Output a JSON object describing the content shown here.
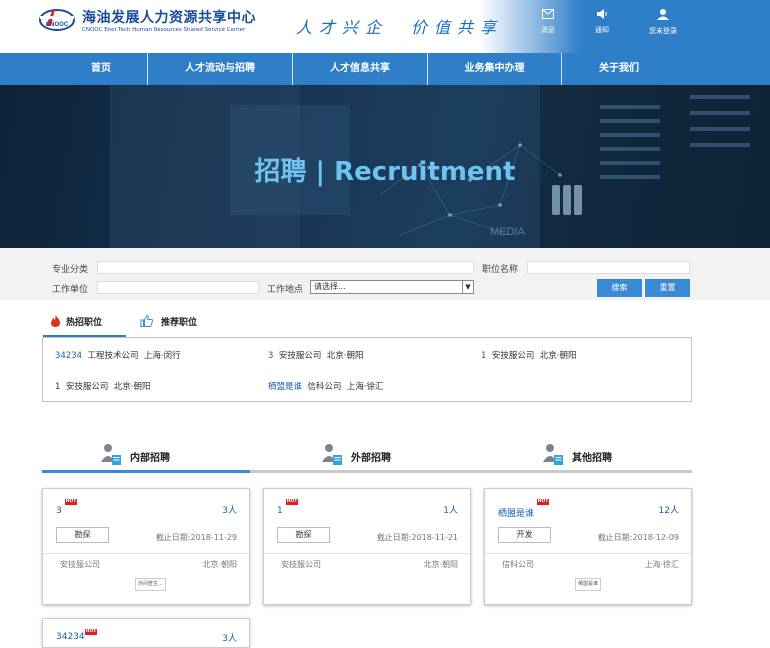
{
  "header": {
    "logo_title": "海油发展人力资源共享中心",
    "logo_subtitle": "CNOOC Ener.Tech Human Resources Shared Service Center",
    "logo_mark_text": "CNOOC",
    "slogan": "人才兴企　价值共享",
    "icons": [
      {
        "name": "message-icon",
        "label": "消息"
      },
      {
        "name": "notification-icon",
        "label": "通知"
      },
      {
        "name": "user-icon",
        "label": "您未登录"
      }
    ]
  },
  "nav": [
    "首页",
    "人才流动与招聘",
    "人才信息共享",
    "业务集中办理",
    "关于我们"
  ],
  "banner": {
    "title": "招聘 | Recruitment",
    "deco_text": "MEDIA"
  },
  "search": {
    "label_category": "专业分类",
    "label_position": "职位名称",
    "label_unit": "工作单位",
    "label_location": "工作地点",
    "location_select": "请选择...",
    "search_button": "搜索",
    "reset_button": "重置"
  },
  "hot_tabs": {
    "hot": "热招职位",
    "recommended": "推荐职位"
  },
  "hot_jobs": [
    {
      "title": "34234",
      "company": "工程技术公司",
      "location": "上海·闵行"
    },
    {
      "title": "3",
      "company": "安技服公司",
      "location": "北京·朝阳"
    },
    {
      "title": "1",
      "company": "安技服公司",
      "location": "北京·朝阳"
    },
    {
      "title": "1",
      "company": "安技服公司",
      "location": "北京·朝阳"
    },
    {
      "title": "栖盟是谁",
      "company": "信科公司",
      "location": "上海·徐汇"
    }
  ],
  "categories": [
    "内部招聘",
    "外部招聘",
    "其他招聘"
  ],
  "cards": [
    {
      "title": "3",
      "hot": "HOT",
      "count": "3人",
      "tag": "勘探",
      "date": "截止日期:2018-11-29",
      "company": "安技服公司",
      "location": "北京·朝阳",
      "more": "外间查生..."
    },
    {
      "title": "1",
      "hot": "HOT",
      "count": "1人",
      "tag": "勘探",
      "date": "截止日期:2018-11-21",
      "company": "安技服公司",
      "location": "北京·朝阳",
      "more": ""
    },
    {
      "title": "栖盟是谁",
      "hot": "HOT",
      "count": "12人",
      "tag": "开发",
      "date": "截止日期:2018-12-09",
      "company": "信科公司",
      "location": "上海·徐汇",
      "more": "栖盟是谁"
    },
    {
      "title": "34234",
      "hot": "HOT",
      "count": "3人",
      "tag": "",
      "date": "",
      "company": "",
      "location": "",
      "more": ""
    }
  ],
  "colors": {
    "brand_blue": "#2f7fc8",
    "link_blue": "#1a5fa8",
    "hot_red": "#e02020",
    "banner_title": "#6ec3f0"
  }
}
